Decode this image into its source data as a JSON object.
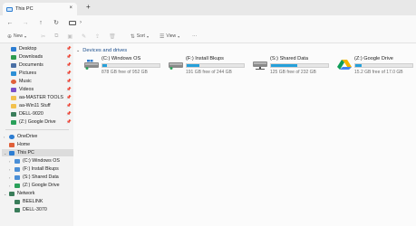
{
  "window": {
    "tab_title": "This PC",
    "tab_close": "×",
    "new_tab": "+"
  },
  "nav": {
    "back": "←",
    "forward": "→",
    "up": "↑",
    "refresh": "↻",
    "breadcrumb_separator": "›"
  },
  "toolbar": {
    "new_label": "New",
    "sort_label": "Sort",
    "view_label": "View",
    "more_label": "···"
  },
  "sidebar": {
    "quick_access": [
      {
        "label": "Desktop",
        "icon": "desktop-icon",
        "color": "#2d7dd2"
      },
      {
        "label": "Downloads",
        "icon": "download-icon",
        "color": "#2d9b4e"
      },
      {
        "label": "Documents",
        "icon": "documents-icon",
        "color": "#4a6fa5"
      },
      {
        "label": "Pictures",
        "icon": "pictures-icon",
        "color": "#2c8fd6"
      },
      {
        "label": "Music",
        "icon": "music-icon",
        "color": "#e0603a"
      },
      {
        "label": "Videos",
        "icon": "videos-icon",
        "color": "#7b4fc9"
      },
      {
        "label": "aa-MASTER TOOLS",
        "icon": "folder-icon",
        "color": "#f2c14e"
      },
      {
        "label": "aa-Win11 Stuff",
        "icon": "folder-icon",
        "color": "#f2c14e"
      },
      {
        "label": "DELL-9020",
        "icon": "network-pc-icon",
        "color": "#3a7d5a"
      },
      {
        "label": "(Z:) Google Drive",
        "icon": "google-drive-icon",
        "color": "#2aa05a"
      }
    ],
    "onedrive": {
      "label": "OneDrive",
      "icon": "cloud-icon",
      "color": "#2d7dd2"
    },
    "home": {
      "label": "Home",
      "icon": "home-icon",
      "color": "#e0603a"
    },
    "this_pc": {
      "label": "This PC",
      "icon": "computer-icon",
      "color": "#2d7dd2"
    },
    "drives": [
      {
        "label": "(C:) Windows OS",
        "icon": "drive-icon",
        "color": "#4b8fd6"
      },
      {
        "label": "(F:) Install Bkups",
        "icon": "drive-icon",
        "color": "#4b8fd6"
      },
      {
        "label": "(S:) Shared Data",
        "icon": "network-drive-icon",
        "color": "#4b8fd6"
      },
      {
        "label": "(Z:) Google Drive",
        "icon": "google-drive-icon",
        "color": "#2aa05a"
      }
    ],
    "network": {
      "label": "Network",
      "icon": "network-icon",
      "color": "#3a7d5a"
    },
    "network_items": [
      {
        "label": "BEELINK",
        "icon": "network-pc-icon",
        "color": "#3a7d5a"
      },
      {
        "label": "DELL-3070",
        "icon": "network-pc-icon",
        "color": "#3a7d5a"
      }
    ]
  },
  "main": {
    "group_title": "Devices and drives",
    "drives": [
      {
        "name": "(C:) Windows OS",
        "free_text": "878 GB free of 952 GB",
        "used_fraction": 0.08,
        "icon": "windows-drive-icon"
      },
      {
        "name": "(F:) Install Bkups",
        "free_text": "191 GB free of 244 GB",
        "used_fraction": 0.22,
        "icon": "drive-icon"
      },
      {
        "name": "(S:) Shared Data",
        "free_text": "125 GB free of 232 GB",
        "used_fraction": 0.46,
        "icon": "network-drive-icon"
      },
      {
        "name": "(Z:) Google Drive",
        "free_text": "15.2 GB free of 17.0 GB",
        "used_fraction": 0.11,
        "icon": "google-drive-icon"
      }
    ]
  },
  "colors": {
    "accent": "#26a0da",
    "group_header": "#1a4d8c"
  }
}
